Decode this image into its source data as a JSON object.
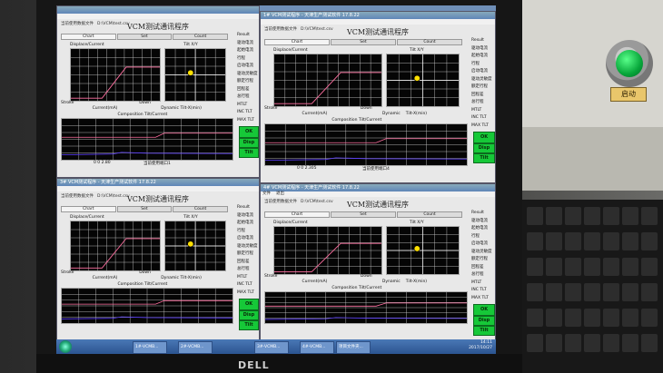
{
  "hardware": {
    "start_button_label": "启动",
    "monitor_brand": "DELL"
  },
  "windows": [
    {
      "id": "tl",
      "title": "",
      "file_label": "当前使用数据文件",
      "file_path": "D:\\VCM\\test.csv",
      "app_title": "VCM测试通讯程序",
      "tabs": [
        "Chart",
        "Set",
        "Count"
      ],
      "plot1_title": "Displace/Current",
      "plot2_title": "Tilt X/Y",
      "plot3_title": "Composition Tilt/Current",
      "xlabel": "Current(mA)",
      "xlabel2": "Tilt-X(min)",
      "legend": [
        "Stroke",
        "Down"
      ],
      "legend2": "Dynamic",
      "status_text": "当前使用端口1",
      "small_text": "0 0 2.80"
    },
    {
      "id": "tr",
      "title": "1# VCM测试程序 - 天津生产测试软件 17.8.22",
      "file_label": "当前使用数据文件",
      "file_path": "D:\\VCM\\test.csv",
      "app_title": "VCM测试通讯程序",
      "tabs": [
        "Chart",
        "Set",
        "Count"
      ],
      "plot1_title": "Displace/Current",
      "plot2_title": "Tilt X/Y",
      "plot3_title": "Composition Tilt/Current",
      "xlabel": "Current(mA)",
      "xlabel2": "Tilt-X(min)",
      "legend": [
        "Stroke",
        "Down"
      ],
      "legend2": "Dynamic",
      "status_text": "当前使用端口4",
      "small_text": "0 0 2.305"
    },
    {
      "id": "bl",
      "title": "3# VCM测试程序 - 天津生产测试软件 17.8.22",
      "file_label": "当前使用数据文件",
      "file_path": "D:\\VCM\\test.csv",
      "app_title": "VCM测试通讯程序",
      "tabs": [
        "Chart",
        "Set",
        "Count"
      ],
      "plot1_title": "Displace/Current",
      "plot2_title": "Tilt X/Y",
      "plot3_title": "Composition Tilt/Current",
      "xlabel": "Current(mA)",
      "xlabel2": "Tilt-X(min)",
      "legend": [
        "Stroke",
        "Down"
      ],
      "legend2": "Dynamic",
      "status_text": "",
      "small_text": ""
    },
    {
      "id": "br",
      "title": "4# VCM测试程序 - 天津生产测试软件 17.8.22",
      "file_label": "当前使用数据文件",
      "file_path": "D:\\VCM\\test.csv",
      "app_title": "VCM测试通讯程序",
      "tabs": [
        "Chart",
        "Set",
        "Count"
      ],
      "menu": [
        "文件",
        "退出"
      ],
      "plot1_title": "Displace/Current",
      "plot2_title": "Tilt X/Y",
      "plot3_title": "Composition Tilt/Current",
      "xlabel": "Current(mA)",
      "xlabel2": "Tilt-X(min)",
      "legend": [
        "Stroke",
        "Down"
      ],
      "legend2": "Dynamic",
      "status_text": "",
      "small_text": ""
    }
  ],
  "results": {
    "header": "Result",
    "items": [
      "驱动电流",
      "起始电流",
      "行程",
      "启动电流",
      "驱动灵敏度",
      "额定行程",
      "回程差",
      "总行程",
      "MTLT",
      "INC TLT",
      "MAX TLT"
    ],
    "buttons": {
      "ok": "OK",
      "disp": "Disp",
      "tilt": "Tilt"
    }
  },
  "taskbar": {
    "items": [
      "1#-VCMB...",
      "2#-VCMB...",
      "3#-VCMB...",
      "4#-VCMB...",
      "项目文件夹..."
    ],
    "time": "14:11",
    "date": "2017/10/27"
  },
  "colors": {
    "accent_green": "#16c838",
    "plot_bg": "#050505",
    "curve_pink": "#ff6fa0",
    "curve_blue": "#5a3cff",
    "marker_yellow": "#ffe000"
  }
}
